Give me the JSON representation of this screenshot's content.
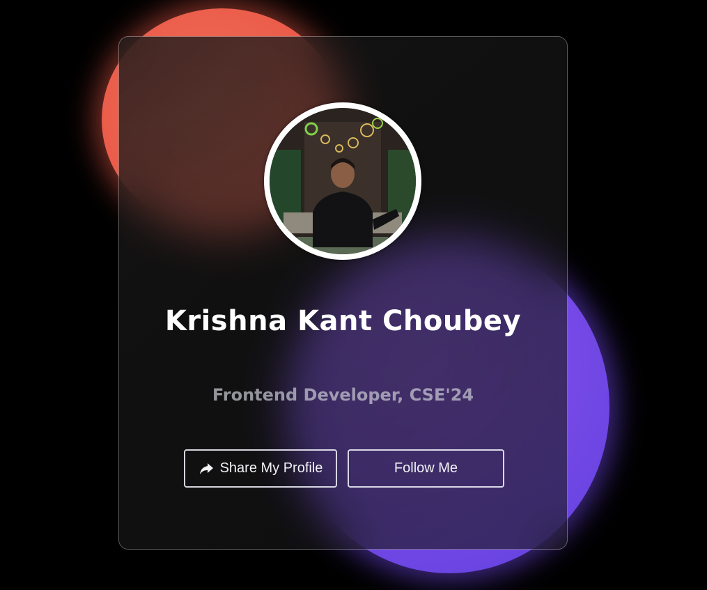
{
  "profile": {
    "name": "Krishna Kant Choubey",
    "role": "Frontend Developer, CSE'24"
  },
  "actions": {
    "share_label": "Share My Profile",
    "share_icon": "share-arrow-icon",
    "follow_label": "Follow Me"
  },
  "colors": {
    "background": "#000000",
    "orange_blob": "#ea5a48",
    "purple_blob": "#7549e6",
    "card": "#1a1a1a",
    "name_text": "#ffffff",
    "role_text": "#c8c8d2"
  }
}
